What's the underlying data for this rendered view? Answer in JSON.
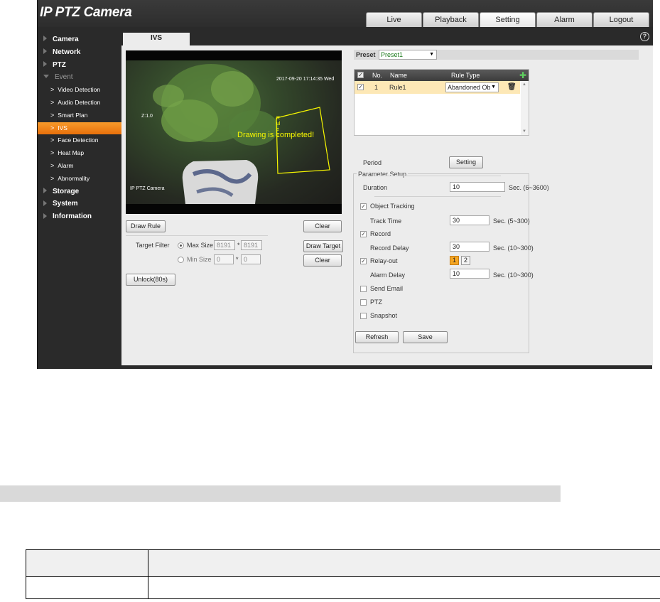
{
  "app": {
    "title": "IP PTZ Camera"
  },
  "top_tabs": [
    {
      "label": "Live"
    },
    {
      "label": "Playback"
    },
    {
      "label": "Setting",
      "active": true
    },
    {
      "label": "Alarm"
    },
    {
      "label": "Logout"
    }
  ],
  "sidebar": {
    "camera": "Camera",
    "network": "Network",
    "ptz": "PTZ",
    "event": "Event",
    "event_items": [
      "Video Detection",
      "Audio Detection",
      "Smart Plan",
      "IVS",
      "Face Detection",
      "Heat Map",
      "Alarm",
      "Abnormality"
    ],
    "active_item": "IVS",
    "storage": "Storage",
    "system": "System",
    "information": "Information"
  },
  "content_tab": {
    "label": "IVS"
  },
  "video": {
    "timestamp": "2017-09-20 17:14:35 Wed",
    "zoom": "Z:1.0",
    "channel_name": "IP PTZ Camera",
    "message": "Drawing is completed!",
    "rule_label": "Rule1"
  },
  "left_controls": {
    "draw_rule": "Draw Rule",
    "clear": "Clear",
    "target_filter_label": "Target Filter",
    "max_size_label": "Max Size",
    "max_w": "8191",
    "max_h": "8191",
    "min_size_label": "Min Size",
    "min_w": "0",
    "min_h": "0",
    "times": "*",
    "draw_target": "Draw Target",
    "clear2": "Clear",
    "unlock": "Unlock(80s)"
  },
  "preset": {
    "label": "Preset",
    "value": "Preset1"
  },
  "rules_table": {
    "headers": {
      "no": "No.",
      "name": "Name",
      "rule_type": "Rule Type"
    },
    "rows": [
      {
        "no": "1",
        "name": "Rule1",
        "rule_type": "Abandoned Ob"
      }
    ]
  },
  "params": {
    "legend": "Parameter Setup",
    "period_label": "Period",
    "setting_btn": "Setting",
    "duration_label": "Duration",
    "duration_value": "10",
    "duration_range": "Sec. (6~3600)",
    "object_tracking": "Object Tracking",
    "track_time_label": "Track Time",
    "track_time_value": "30",
    "track_time_range": "Sec. (5~300)",
    "record": "Record",
    "record_delay_label": "Record Delay",
    "record_delay_value": "30",
    "record_delay_range": "Sec. (10~300)",
    "relay_out": "Relay-out",
    "relay_1": "1",
    "relay_2": "2",
    "alarm_delay_label": "Alarm Delay",
    "alarm_delay_value": "10",
    "alarm_delay_range": "Sec. (10~300)",
    "send_email": "Send Email",
    "ptz": "PTZ",
    "snapshot": "Snapshot"
  },
  "bottom_buttons": {
    "refresh": "Refresh",
    "save": "Save"
  },
  "colors": {
    "accent": "#f08a1c",
    "sidebar_bg": "#2a2a2a",
    "content_bg": "#ececec",
    "draw_yellow": "#f7f700",
    "selected_row": "#fde8b6"
  }
}
